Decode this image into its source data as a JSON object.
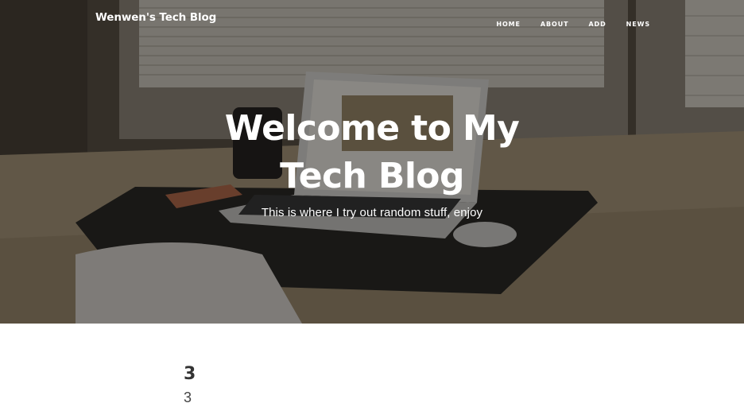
{
  "navbar": {
    "brand": "Wenwen's Tech Blog",
    "links": [
      "Home",
      "About",
      "Add",
      "News"
    ]
  },
  "hero": {
    "title": "Welcome to My Tech Blog",
    "subtitle": "This is where I try out random stuff, enjoy"
  },
  "posts": [
    {
      "title": "3",
      "subtitle": "3"
    }
  ]
}
